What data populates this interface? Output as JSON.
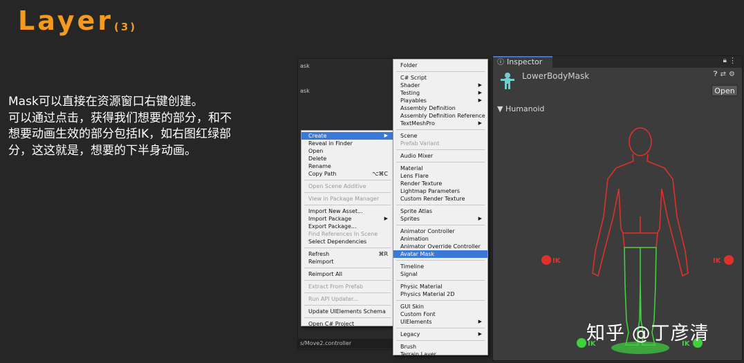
{
  "slide": {
    "title": "Layer",
    "subtitle": "(3)",
    "description": [
      "Mask可以直接在资源窗口右键创建。",
      "可以通过点击，获得我们想要的部分，和不",
      "想要动画生效的部分包括IK，如右图红绿部",
      "分，这这就是，想要的下半身动画。"
    ],
    "watermark": "知乎 @丁彦清"
  },
  "project_window": {
    "fragments": [
      "ask",
      "ask"
    ],
    "path": "s/Move2.controller"
  },
  "context_menu": {
    "items": [
      {
        "label": "Create",
        "submenu": true,
        "selected": true
      },
      {
        "label": "Reveal in Finder"
      },
      {
        "label": "Open"
      },
      {
        "label": "Delete"
      },
      {
        "label": "Rename"
      },
      {
        "label": "Copy Path",
        "shortcut": "⌥⌘C"
      },
      {
        "label": "Open Scene Additive",
        "disabled": true
      },
      {
        "label": "View in Package Manager",
        "disabled": true
      },
      {
        "label": "Import New Asset..."
      },
      {
        "label": "Import Package",
        "submenu": true
      },
      {
        "label": "Export Package..."
      },
      {
        "label": "Find References In Scene",
        "disabled": true
      },
      {
        "label": "Select Dependencies"
      },
      {
        "label": "Refresh",
        "shortcut": "⌘R"
      },
      {
        "label": "Reimport"
      },
      {
        "label": "Reimport All"
      },
      {
        "label": "Extract From Prefab",
        "disabled": true
      },
      {
        "label": "Run API Updater...",
        "disabled": true
      },
      {
        "label": "Update UIElements Schema"
      },
      {
        "label": "Open C# Project"
      }
    ]
  },
  "create_submenu": {
    "items": [
      {
        "label": "Folder"
      },
      {
        "label": "C# Script"
      },
      {
        "label": "Shader",
        "submenu": true
      },
      {
        "label": "Testing",
        "submenu": true
      },
      {
        "label": "Playables",
        "submenu": true
      },
      {
        "label": "Assembly Definition"
      },
      {
        "label": "Assembly Definition Reference"
      },
      {
        "label": "TextMeshPro",
        "submenu": true
      },
      {
        "label": "Scene"
      },
      {
        "label": "Prefab Variant",
        "disabled": true
      },
      {
        "label": "Audio Mixer"
      },
      {
        "label": "Material"
      },
      {
        "label": "Lens Flare"
      },
      {
        "label": "Render Texture"
      },
      {
        "label": "Lightmap Parameters"
      },
      {
        "label": "Custom Render Texture"
      },
      {
        "label": "Sprite Atlas"
      },
      {
        "label": "Sprites",
        "submenu": true
      },
      {
        "label": "Animator Controller"
      },
      {
        "label": "Animation"
      },
      {
        "label": "Animator Override Controller"
      },
      {
        "label": "Avatar Mask",
        "selected": true
      },
      {
        "label": "Timeline"
      },
      {
        "label": "Signal"
      },
      {
        "label": "Physic Material"
      },
      {
        "label": "Physics Material 2D"
      },
      {
        "label": "GUI Skin"
      },
      {
        "label": "Custom Font"
      },
      {
        "label": "UIElements",
        "submenu": true
      },
      {
        "label": "Legacy",
        "submenu": true
      },
      {
        "label": "Brush"
      },
      {
        "label": "Terrain Layer"
      }
    ]
  },
  "inspector": {
    "tab_label": "Inspector",
    "asset_name": "LowerBodyMask",
    "open_label": "Open",
    "section_label": "Humanoid",
    "ik_labels": {
      "left_hand": "IK",
      "right_hand": "IK",
      "left_foot": "IK",
      "right_foot": "IK"
    },
    "colors": {
      "active_part": "#3ed13e",
      "inactive_part": "#e0302a",
      "selection": "#3b79d8"
    }
  }
}
